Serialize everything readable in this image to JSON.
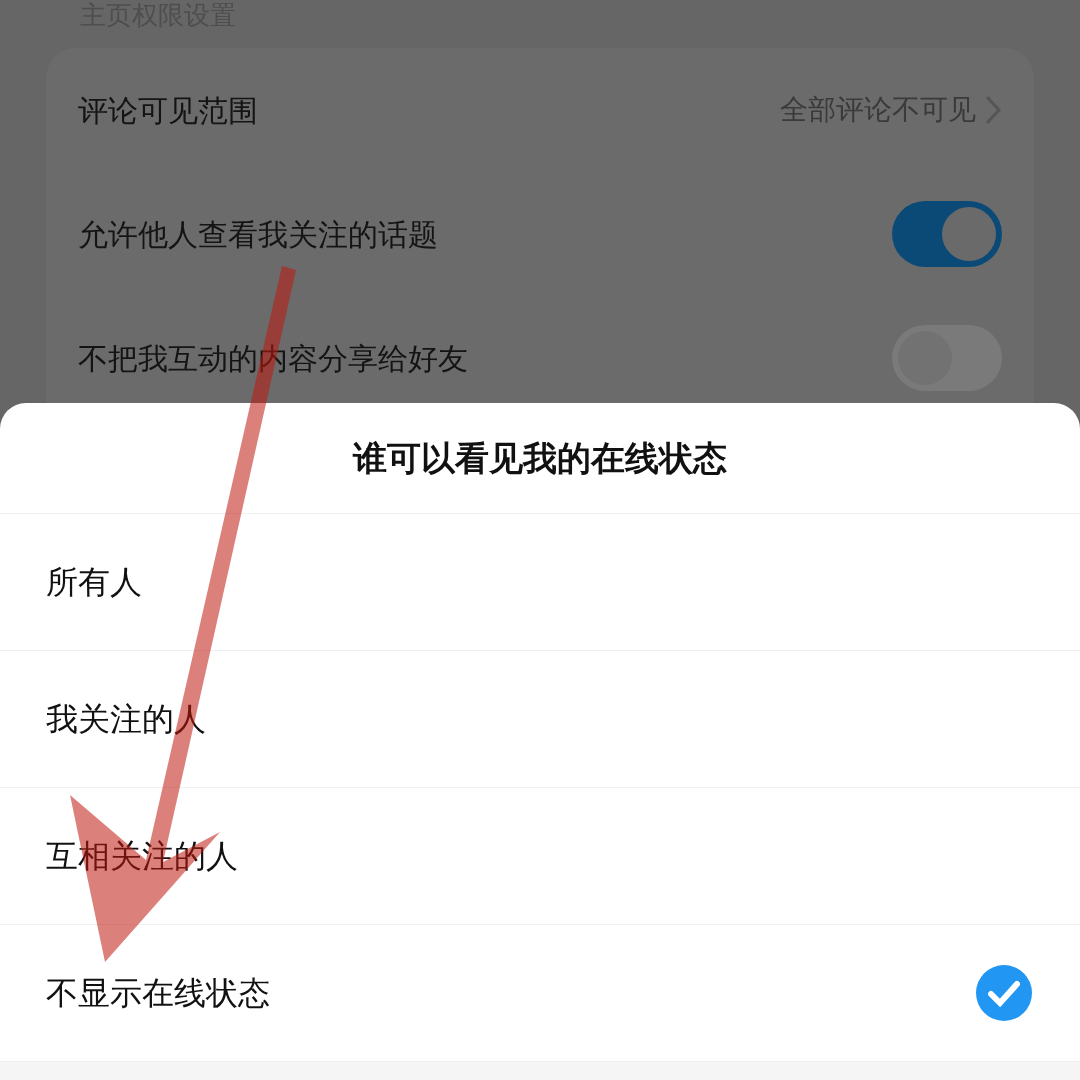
{
  "section_title": "主页权限设置",
  "settings": [
    {
      "kind": "link",
      "label": "评论可见范围",
      "value": "全部评论不可见"
    },
    {
      "kind": "toggle",
      "label": "允许他人查看我关注的话题",
      "on": true
    },
    {
      "kind": "toggle",
      "label": "不把我互动的内容分享给好友",
      "on": false
    }
  ],
  "sheet": {
    "title": "谁可以看见我的在线状态",
    "options": [
      {
        "label": "所有人",
        "selected": false
      },
      {
        "label": "我关注的人",
        "selected": false
      },
      {
        "label": "互相关注的人",
        "selected": false
      },
      {
        "label": "不显示在线状态",
        "selected": true
      }
    ]
  }
}
